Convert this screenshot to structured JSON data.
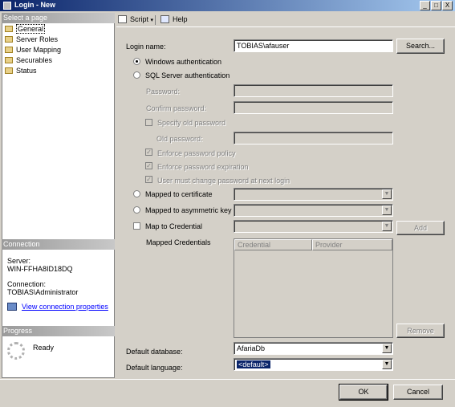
{
  "window": {
    "title": "Login - New",
    "controls": {
      "minimize": "_",
      "maximize": "□",
      "close": "X"
    }
  },
  "left_pane": {
    "select_page_header": "Select a page",
    "pages": [
      {
        "label": "General",
        "icon": "page-icon",
        "selected": true
      },
      {
        "label": "Server Roles",
        "icon": "page-icon"
      },
      {
        "label": "User Mapping",
        "icon": "page-icon"
      },
      {
        "label": "Securables",
        "icon": "page-icon"
      },
      {
        "label": "Status",
        "icon": "page-icon"
      }
    ],
    "connection_header": "Connection",
    "server_label": "Server:",
    "server_value": "WIN-FFHA8ID18DQ",
    "connection_label": "Connection:",
    "connection_value": "TOBIAS\\Administrator",
    "view_connection_properties": "View connection properties",
    "progress_header": "Progress",
    "progress_status": "Ready"
  },
  "toolbar": {
    "script_label": "Script",
    "help_label": "Help"
  },
  "form": {
    "login_name_label": "Login name:",
    "login_name_value": "TOBIAS\\afauser",
    "search_button": "Search...",
    "windows_auth_label": "Windows authentication",
    "sql_auth_label": "SQL Server authentication",
    "password_label": "Password:",
    "confirm_password_label": "Confirm password:",
    "specify_old_password_label": "Specify old password",
    "old_password_label": "Old password:",
    "enforce_policy_label": "Enforce password policy",
    "enforce_expiration_label": "Enforce password expiration",
    "must_change_label": "User must change password at next login",
    "mapped_cert_label": "Mapped to certificate",
    "mapped_asym_label": "Mapped to asymmetric key",
    "map_credential_label": "Map to Credential",
    "add_button": "Add",
    "mapped_credentials_label": "Mapped Credentials",
    "grid_columns": [
      "Credential",
      "Provider"
    ],
    "remove_button": "Remove",
    "default_database_label": "Default database:",
    "default_database_value": "AfariaDb",
    "default_language_label": "Default language:",
    "default_language_value": "<default>"
  },
  "footer": {
    "ok_button": "OK",
    "cancel_button": "Cancel"
  },
  "colors": {
    "titlebar_start": "#0a246a",
    "titlebar_end": "#a6caf0",
    "dialog_bg": "#d4d0c8",
    "link": "#0000ff",
    "selection": "#0a246a"
  }
}
